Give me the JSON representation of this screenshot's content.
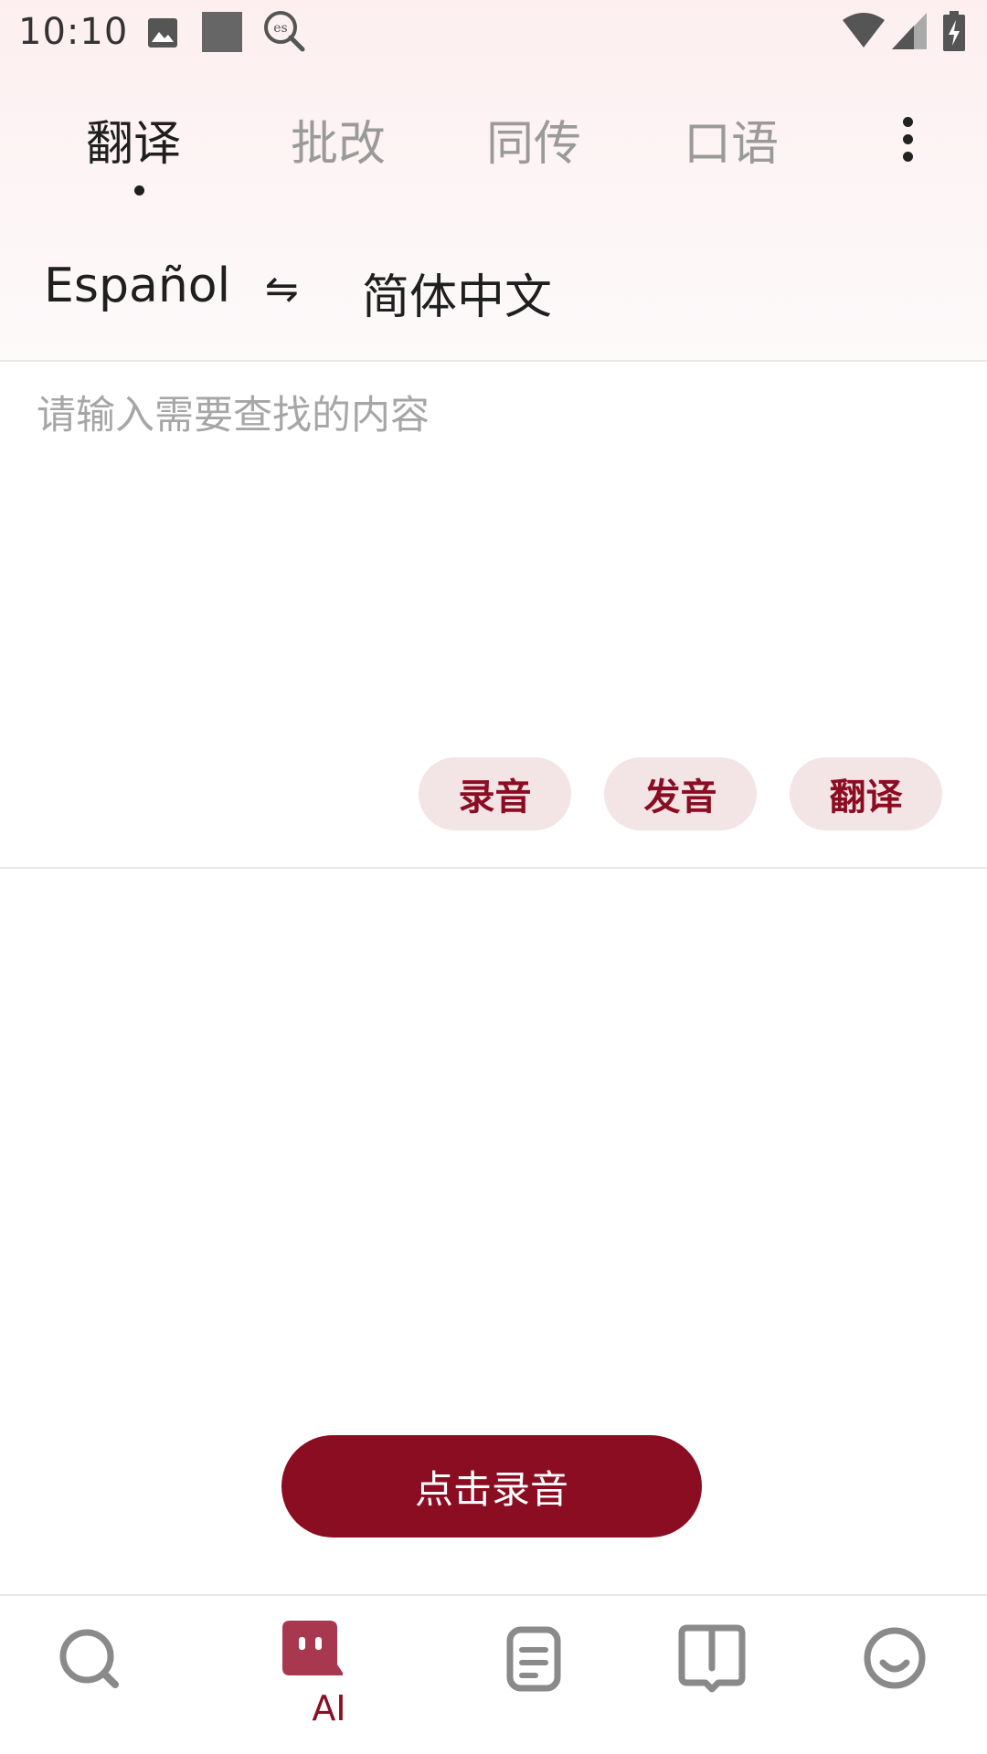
{
  "status_bar": {
    "time": "10:10",
    "icons": [
      "image-icon",
      "square-icon",
      "es-search-icon",
      "wifi-icon",
      "signal-icon",
      "battery-charging-icon"
    ]
  },
  "tabs": [
    {
      "label": "翻译",
      "active": true
    },
    {
      "label": "批改",
      "active": false
    },
    {
      "label": "同传",
      "active": false
    },
    {
      "label": "口语",
      "active": false
    }
  ],
  "languages": {
    "source": "Español",
    "target": "简体中文",
    "swap_icon": "⇋"
  },
  "input": {
    "placeholder": "请输入需要查找的内容",
    "value": ""
  },
  "actions": {
    "record": "录音",
    "pronounce": "发音",
    "translate": "翻译"
  },
  "record_button_label": "点击录音",
  "bottom_nav": {
    "items": [
      {
        "icon": "search-icon"
      },
      {
        "icon": "ai-robot-icon",
        "label": "AI",
        "active": true
      },
      {
        "icon": "notes-icon"
      },
      {
        "icon": "book-icon"
      },
      {
        "icon": "smiley-icon"
      }
    ]
  },
  "colors": {
    "accent": "#8b0d22",
    "chip_bg": "#f3e4e6",
    "inactive_text": "#9a9a9a",
    "ai_icon": "#a8384f"
  }
}
